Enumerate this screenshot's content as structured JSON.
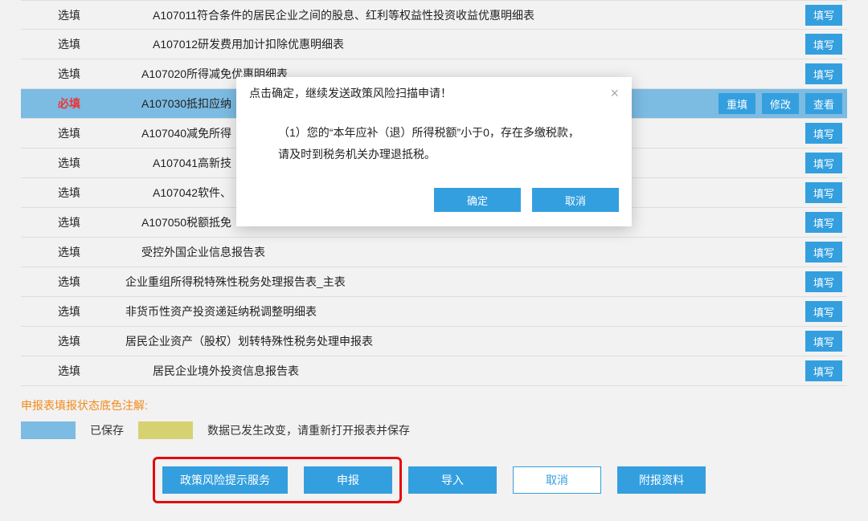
{
  "rows": [
    {
      "status": "选填",
      "required": false,
      "indent": 2,
      "name": "A107011符合条件的居民企业之间的股息、红利等权益性投资收益优惠明细表",
      "actions": [
        "填写"
      ]
    },
    {
      "status": "选填",
      "required": false,
      "indent": 2,
      "name": "A107012研发费用加计扣除优惠明细表",
      "actions": [
        "填写"
      ]
    },
    {
      "status": "选填",
      "required": false,
      "indent": 1,
      "name": "A107020所得减免优惠明细表",
      "actions": [
        "填写"
      ]
    },
    {
      "status": "必填",
      "required": true,
      "indent": 1,
      "name": "A107030抵扣应纳",
      "actions": [
        "重填",
        "修改",
        "查看"
      ],
      "highlight": true
    },
    {
      "status": "选填",
      "required": false,
      "indent": 1,
      "name": "A107040减免所得",
      "actions": [
        "填写"
      ]
    },
    {
      "status": "选填",
      "required": false,
      "indent": 2,
      "name": "A107041高新技",
      "actions": [
        "填写"
      ]
    },
    {
      "status": "选填",
      "required": false,
      "indent": 2,
      "name": "A107042软件、",
      "actions": [
        "填写"
      ]
    },
    {
      "status": "选填",
      "required": false,
      "indent": 1,
      "name": "A107050税额抵免",
      "actions": [
        "填写"
      ]
    },
    {
      "status": "选填",
      "required": false,
      "indent": 1,
      "name": "受控外国企业信息报告表",
      "actions": [
        "填写"
      ]
    },
    {
      "status": "选填",
      "required": false,
      "indent": 0,
      "name": "企业重组所得税特殊性税务处理报告表_主表",
      "actions": [
        "填写"
      ]
    },
    {
      "status": "选填",
      "required": false,
      "indent": 0,
      "name": "非货币性资产投资递延纳税调整明细表",
      "actions": [
        "填写"
      ]
    },
    {
      "status": "选填",
      "required": false,
      "indent": 0,
      "name": "居民企业资产（股权）划转特殊性税务处理申报表",
      "actions": [
        "填写"
      ]
    },
    {
      "status": "选填",
      "required": false,
      "indent": 2,
      "name": "居民企业境外投资信息报告表",
      "actions": [
        "填写"
      ]
    }
  ],
  "legend": {
    "title": "申报表填报状态底色注解:",
    "saved": "已保存",
    "dirty": "数据已发生改变，请重新打开报表并保存"
  },
  "footer": {
    "risk": "政策风险提示服务",
    "declare": "申报",
    "import": "导入",
    "cancel": "取消",
    "attach": "附报资料"
  },
  "modal": {
    "title": "点击确定，继续发送政策风险扫描申请！",
    "body": "（1）您的“本年应补（退）所得税额”小于0，存在多缴税款，请及时到税务机关办理退抵税。",
    "ok": "确定",
    "cancel": "取消"
  },
  "row_action_labels": {
    "填写": "填写",
    "重填": "重填",
    "修改": "修改",
    "查看": "查看"
  }
}
